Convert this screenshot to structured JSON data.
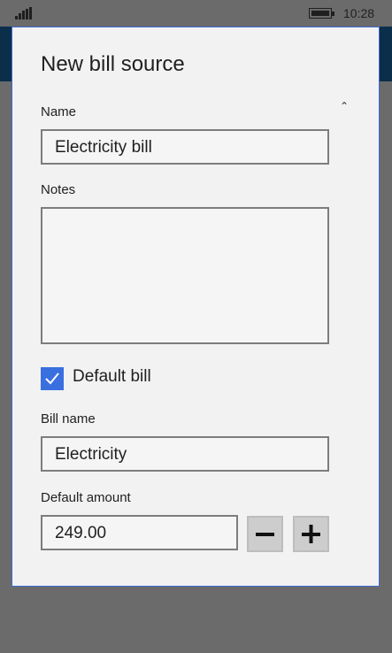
{
  "status_bar": {
    "time": "10:28"
  },
  "dialog": {
    "title": "New bill source",
    "name_label": "Name",
    "name_value": "Electricity bill",
    "notes_label": "Notes",
    "notes_value": "",
    "default_bill_label": "Default bill",
    "default_bill_checked": true,
    "bill_name_label": "Bill name",
    "bill_name_value": "Electricity",
    "default_amount_label": "Default amount",
    "default_amount_value": "249.00"
  },
  "icons": {
    "collapse": "chevron-up-icon",
    "decrement": "minus-icon",
    "increment": "plus-icon",
    "checkbox": "checkmark-icon"
  },
  "colors": {
    "accent": "#3a6fe0",
    "dialog_border": "#3e6ad6",
    "background": "#6b6b6b",
    "dialog_bg": "#f2f2f2"
  }
}
